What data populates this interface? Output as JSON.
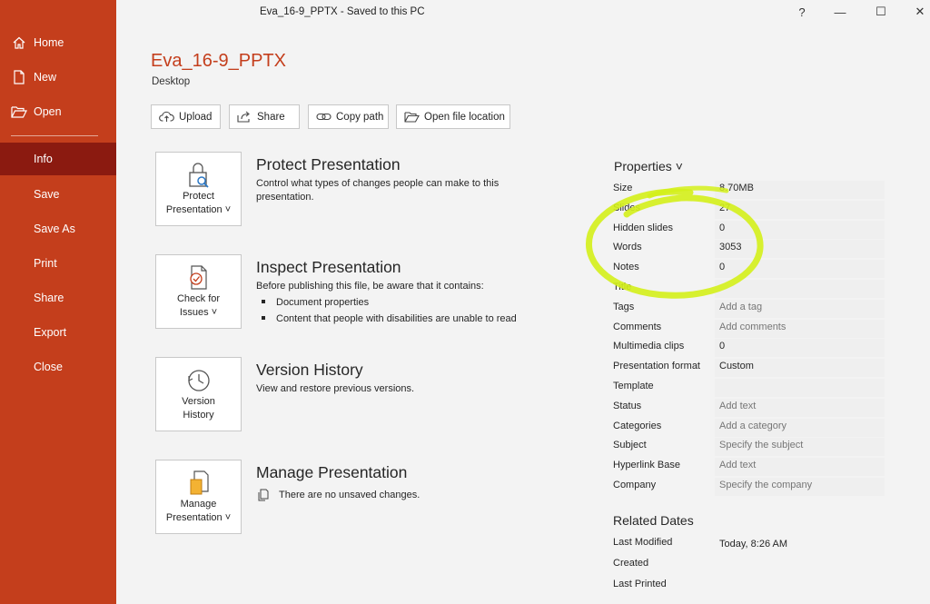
{
  "window": {
    "title": "Eva_16-9_PPTX  -  Saved to this PC",
    "help": "?",
    "minimize": "—",
    "maximize": "☐",
    "close": "✕"
  },
  "sidebar": {
    "items": [
      {
        "label": "Home",
        "icon": "home-icon"
      },
      {
        "label": "New",
        "icon": "new-document-icon"
      },
      {
        "label": "Open",
        "icon": "open-folder-icon"
      },
      {
        "label": "Info",
        "active": true
      },
      {
        "label": "Save"
      },
      {
        "label": "Save As"
      },
      {
        "label": "Print"
      },
      {
        "label": "Share"
      },
      {
        "label": "Export"
      },
      {
        "label": "Close"
      }
    ]
  },
  "file": {
    "name": "Eva_16-9_PPTX",
    "location": "Desktop"
  },
  "toolbar": {
    "upload": "Upload",
    "share": "Share",
    "copy_path": "Copy path",
    "open_location": "Open file location"
  },
  "sections": {
    "protect": {
      "card_line1": "Protect",
      "card_line2": "Presentation ˅",
      "title": "Protect Presentation",
      "desc": "Control what types of changes people can make to this presentation."
    },
    "inspect": {
      "card_line1": "Check for",
      "card_line2": "Issues ˅",
      "title": "Inspect Presentation",
      "desc": "Before publishing this file, be aware that it contains:",
      "bullets": [
        "Document properties",
        "Content that people with disabilities are unable to read"
      ]
    },
    "version": {
      "card_line1": "Version",
      "card_line2": "History",
      "title": "Version History",
      "desc": "View and restore previous versions."
    },
    "manage": {
      "card_line1": "Manage",
      "card_line2": "Presentation ˅",
      "title": "Manage Presentation",
      "desc": "There are no unsaved changes."
    }
  },
  "properties": {
    "heading": "Properties ˅",
    "rows": [
      {
        "key": "Size",
        "value": "8.70MB"
      },
      {
        "key": "Slides",
        "value": "27"
      },
      {
        "key": "Hidden slides",
        "value": "0"
      },
      {
        "key": "Words",
        "value": "3053"
      },
      {
        "key": "Notes",
        "value": "0"
      },
      {
        "key": "Title",
        "value": ""
      },
      {
        "key": "Tags",
        "value": "Add a tag"
      },
      {
        "key": "Comments",
        "value": "Add comments"
      },
      {
        "key": "Multimedia clips",
        "value": "0"
      },
      {
        "key": "Presentation format",
        "value": "Custom"
      },
      {
        "key": "Template",
        "value": ""
      },
      {
        "key": "Status",
        "value": "Add text"
      },
      {
        "key": "Categories",
        "value": "Add a category"
      },
      {
        "key": "Subject",
        "value": "Specify the subject"
      },
      {
        "key": "Hyperlink Base",
        "value": "Add text"
      },
      {
        "key": "Company",
        "value": "Specify the company"
      }
    ]
  },
  "related_dates": {
    "heading": "Related Dates",
    "rows": [
      {
        "key": "Last Modified",
        "value": "Today, 8:26 AM"
      },
      {
        "key": "Created",
        "value": ""
      },
      {
        "key": "Last Printed",
        "value": ""
      }
    ]
  },
  "colors": {
    "sidebar": "#c43e1c",
    "sidebar_active": "#8b1a10",
    "accent_title": "#c43e1c",
    "highlight": "#d4f01a"
  }
}
